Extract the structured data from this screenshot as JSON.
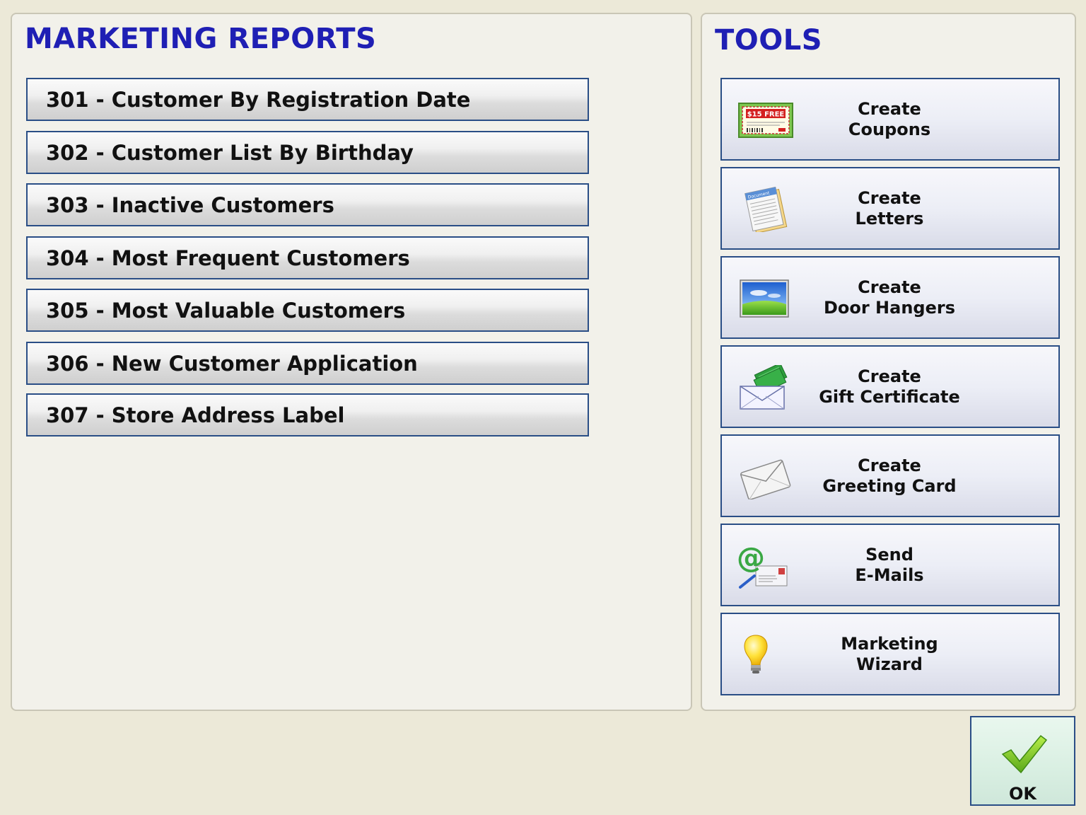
{
  "colors": {
    "title": "#1f1fb4",
    "button_border": "#2a4e86",
    "background": "#ece9d8",
    "panel": "#f2f1ea"
  },
  "reports": {
    "title": "MARKETING REPORTS",
    "items": [
      {
        "label": "301 - Customer By Registration Date"
      },
      {
        "label": "302 - Customer List By Birthday"
      },
      {
        "label": "303 - Inactive Customers"
      },
      {
        "label": "304 - Most Frequent Customers"
      },
      {
        "label": "305 - Most Valuable Customers"
      },
      {
        "label": "306 - New Customer Application"
      },
      {
        "label": "307 - Store Address Label"
      }
    ]
  },
  "tools": {
    "title": "TOOLS",
    "items": [
      {
        "line1": "Create",
        "line2": "Coupons",
        "icon": "coupon-icon",
        "icon_text": "$15 FREE"
      },
      {
        "line1": "Create",
        "line2": "Letters",
        "icon": "document-icon",
        "icon_text": "Document"
      },
      {
        "line1": "Create",
        "line2": "Door Hangers",
        "icon": "picture-icon"
      },
      {
        "line1": "Create",
        "line2": "Gift Certificate",
        "icon": "money-envelope-icon"
      },
      {
        "line1": "Create",
        "line2": "Greeting Card",
        "icon": "envelope-icon"
      },
      {
        "line1": "Send",
        "line2": "E-Mails",
        "icon": "email-at-icon"
      },
      {
        "line1": "Marketing",
        "line2": "Wizard",
        "icon": "lightbulb-icon"
      }
    ]
  },
  "ok": {
    "label": "OK",
    "icon": "checkmark-icon"
  }
}
